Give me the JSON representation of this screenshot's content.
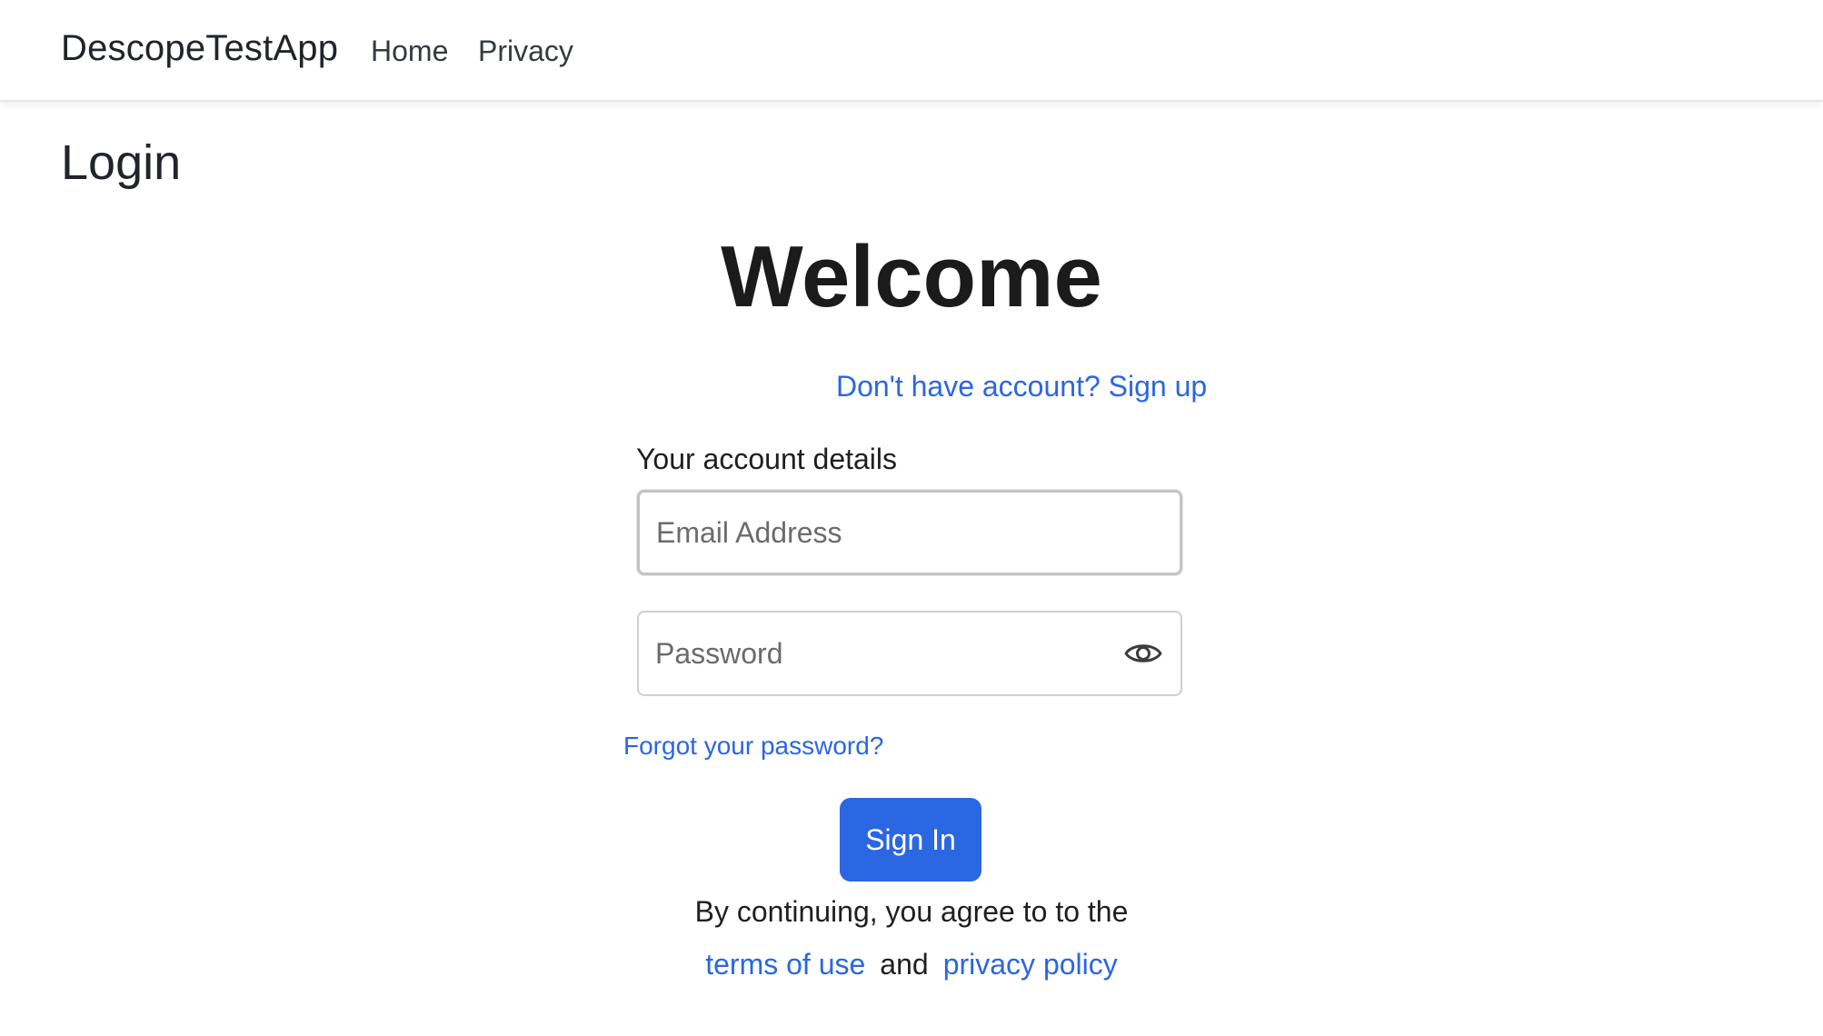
{
  "navbar": {
    "brand": "DescopeTestApp",
    "links": [
      {
        "label": "Home"
      },
      {
        "label": "Privacy"
      }
    ]
  },
  "page": {
    "title": "Login"
  },
  "login_form": {
    "welcome": "Welcome",
    "signup_link": "Don't have account? Sign up",
    "details_label": "Your account details",
    "email_placeholder": "Email Address",
    "password_placeholder": "Password",
    "forgot_link": "Forgot your password?",
    "signin_label": "Sign In",
    "agree_text": "By continuing, you agree to to the",
    "terms_link": "terms of use",
    "and_text": "and",
    "privacy_link": "privacy policy"
  },
  "icons": {
    "password_toggle": "eye-icon"
  },
  "colors": {
    "accent": "#2b66e3",
    "text": "#212529"
  }
}
